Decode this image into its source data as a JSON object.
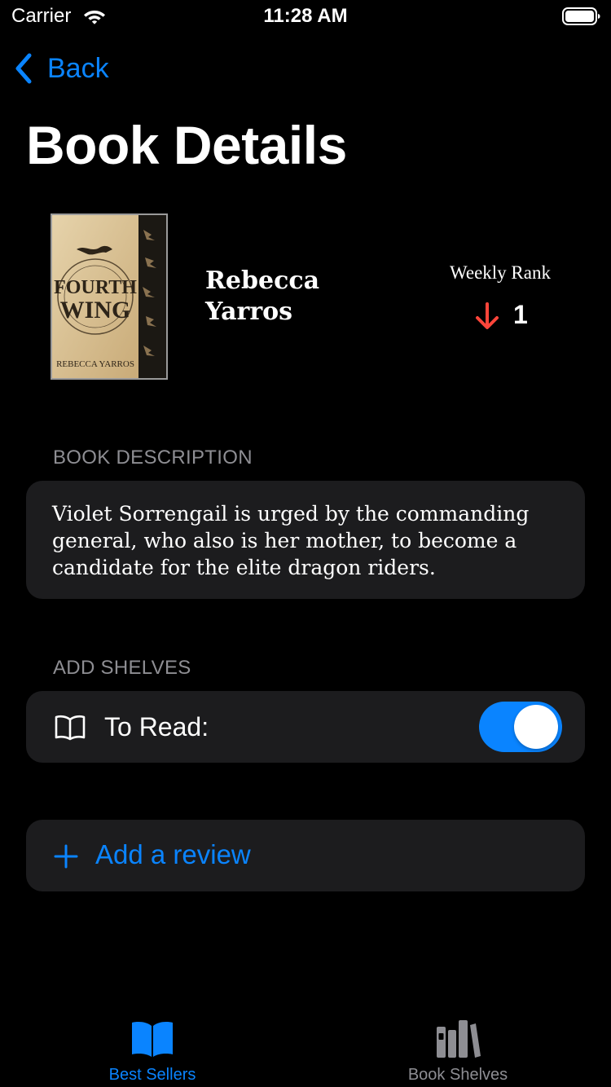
{
  "status_bar": {
    "carrier": "Carrier",
    "time": "11:28 AM",
    "wifi_icon": "wifi-icon",
    "battery_icon": "battery-full-icon"
  },
  "nav": {
    "back_label": "Back",
    "back_icon": "chevron-left-icon",
    "title": "Book Details"
  },
  "book": {
    "cover_title_line1": "FOURTH",
    "cover_title_line2": "WING",
    "cover_author": "REBECCA YARROS",
    "author": "Rebecca Yarros",
    "weekly_rank_label": "Weekly Rank",
    "weekly_rank_value": "1",
    "rank_trend": "down",
    "rank_trend_icon": "arrow-down-icon"
  },
  "description": {
    "header": "BOOK DESCRIPTION",
    "text": "Violet Sorrengail is urged by the commanding general, who also is her mother, to become a candidate for the elite dragon riders."
  },
  "shelves": {
    "header": "ADD SHELVES",
    "items": [
      {
        "icon": "book-open-icon",
        "label": "To Read:",
        "enabled": true
      }
    ]
  },
  "review": {
    "icon": "plus-icon",
    "label": "Add a review"
  },
  "tab_bar": {
    "tabs": [
      {
        "label": "Best Sellers",
        "icon": "book-open-filled-icon",
        "selected": true
      },
      {
        "label": "Book Shelves",
        "icon": "books-vertical-icon",
        "selected": false
      }
    ]
  },
  "colors": {
    "background": "#000000",
    "card": "#1c1c1e",
    "accent": "#0a84ff",
    "secondary_text": "#8e8e93",
    "rank_down": "#ff453a"
  }
}
